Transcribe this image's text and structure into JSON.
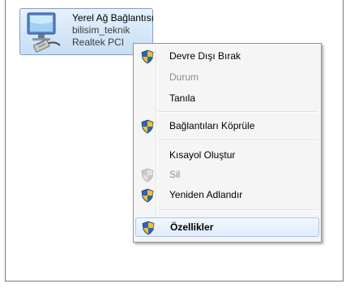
{
  "connection": {
    "name": "Yerel Ağ Bağlantısı",
    "network": "bilisim_teknik",
    "adapter": "Realtek PCI"
  },
  "context_menu": {
    "items": [
      {
        "label": "Devre Dışı Bırak",
        "enabled": true,
        "icon": "uac-shield-icon"
      },
      {
        "label": "Durum",
        "enabled": false,
        "icon": ""
      },
      {
        "label": "Tanıla",
        "enabled": true,
        "icon": ""
      },
      {
        "label": "Bağlantıları Köprüle",
        "enabled": true,
        "icon": "uac-shield-icon"
      },
      {
        "label": "Kısayol Oluştur",
        "enabled": true,
        "icon": ""
      },
      {
        "label": "Sil",
        "enabled": false,
        "icon": "uac-shield-icon"
      },
      {
        "label": "Yeniden Adlandır",
        "enabled": true,
        "icon": "uac-shield-icon"
      },
      {
        "label": "Özellikler",
        "enabled": true,
        "icon": "uac-shield-icon",
        "default": true,
        "highlighted": true
      }
    ]
  },
  "colors": {
    "selection_border": "#7da2ce",
    "menu_background": "#f5f5f5",
    "disabled_text": "#8d8d8d"
  }
}
